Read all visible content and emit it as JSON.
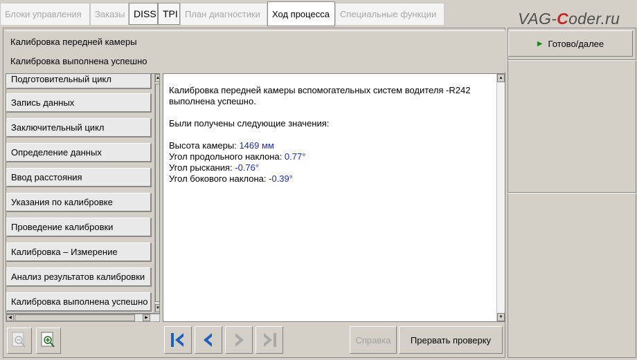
{
  "tabs": [
    {
      "label": "Блоки управления"
    },
    {
      "label": "Заказы"
    },
    {
      "label": "DISS"
    },
    {
      "label": "TPI"
    },
    {
      "label": "План диагностики"
    },
    {
      "label": "Ход процесса"
    },
    {
      "label": "Специальные функции"
    }
  ],
  "watermark": {
    "prefix": "VAG-",
    "accent": "C",
    "suffix": "oder.ru"
  },
  "header": {
    "title": "Калибровка передней камеры",
    "status": "Калибровка выполнена успешно"
  },
  "steps": [
    {
      "label": "Подготовительный цикл"
    },
    {
      "label": "Запись данных"
    },
    {
      "label": "Заключительный цикл"
    },
    {
      "label": "Определение данных"
    },
    {
      "label": "Ввод расстояния"
    },
    {
      "label": "Указания по калибровке"
    },
    {
      "label": "Проведение калибровки"
    },
    {
      "label": "Калибровка – Измерение"
    },
    {
      "label": "Анализ результатов калибровки"
    },
    {
      "label": "Калибровка выполнена успешно"
    }
  ],
  "info": {
    "line1": "Калибровка передней камеры вспомогательных систем водителя -R242",
    "line2": "выполнена успешно.",
    "line3": "Были получены следующие значения:",
    "values": [
      {
        "label": "Высота камеры: ",
        "value": "1469 мм"
      },
      {
        "label": "Угол продольного наклона: ",
        "value": "0.77°"
      },
      {
        "label": "Угол рыскания: ",
        "value": "-0.76°"
      },
      {
        "label": "Угол бокового наклона: ",
        "value": "-0.39°"
      }
    ]
  },
  "toolbar": {
    "help_label": "Справка",
    "abort_label": "Прервать проверку"
  },
  "right": {
    "done_label": "Готово/далее"
  },
  "colors": {
    "nav_blue": "#1f5fc0",
    "nav_disabled": "#a8a8a8",
    "value_blue": "#1a2fa6",
    "accent_red": "#c0262a",
    "done_arrow": "#1a8a1a"
  }
}
